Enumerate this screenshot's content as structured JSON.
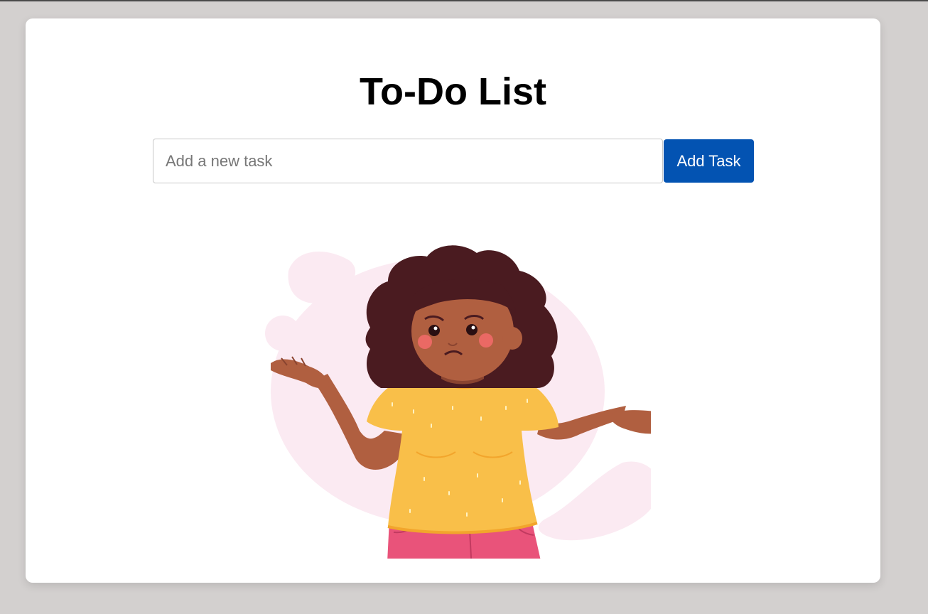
{
  "header": {
    "title": "To-Do List"
  },
  "task_form": {
    "input_value": "",
    "input_placeholder": "Add a new task",
    "add_button_label": "Add Task"
  },
  "empty_state": {
    "illustration": "confused-shrugging-woman-illustration"
  },
  "colors": {
    "page_background": "#d3d0cf",
    "card_background": "#ffffff",
    "button_background": "#0353b2",
    "button_text": "#ffffff",
    "blob_pink": "#fbeaf2",
    "shirt_yellow": "#f9bf49",
    "pants_pink": "#e9537a",
    "skin_brown": "#b05f40",
    "hair_dark": "#4a1b20"
  }
}
